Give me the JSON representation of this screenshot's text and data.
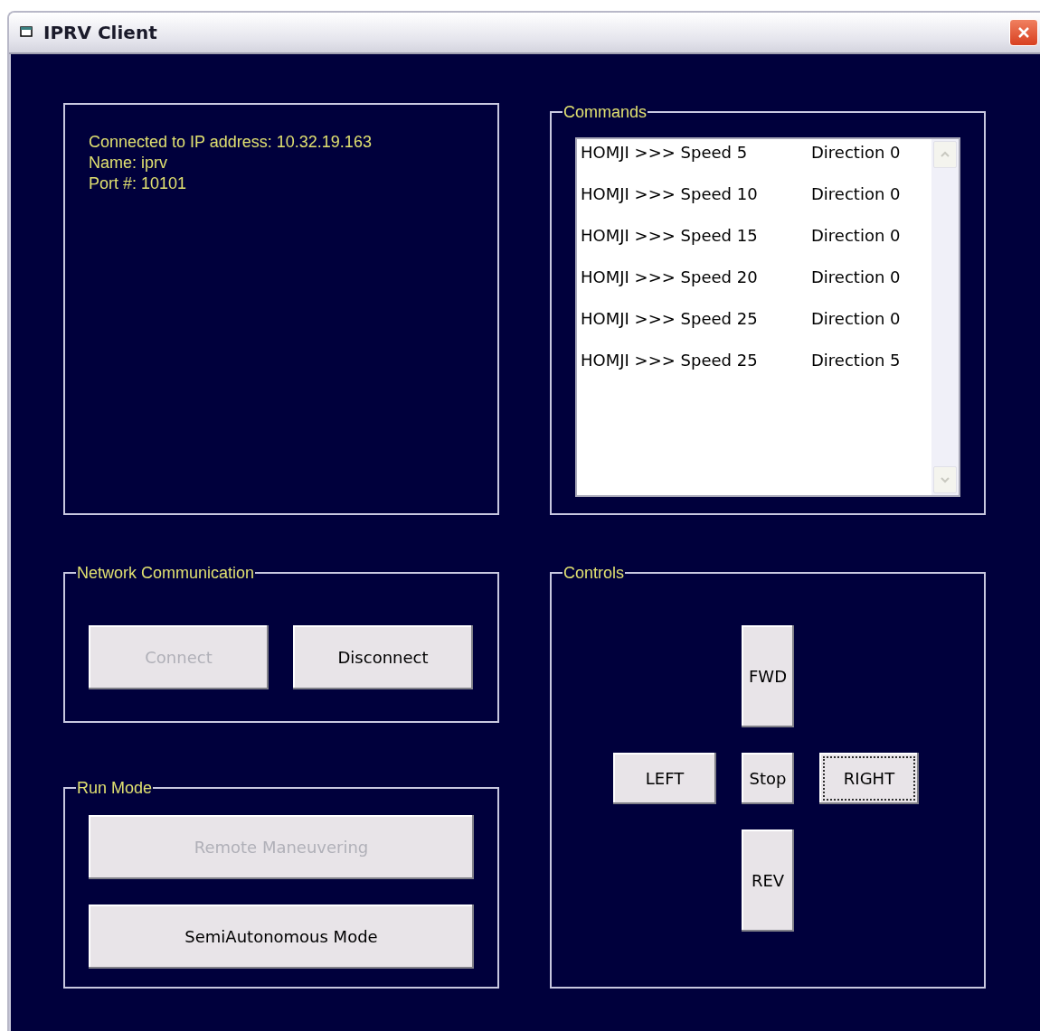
{
  "window": {
    "title": "IPRV Client"
  },
  "status": {
    "lines": [
      "Connected to IP address: 10.32.19.163",
      "Name: iprv",
      "Port #: 10101"
    ]
  },
  "commands": {
    "label": "Commands",
    "items": [
      {
        "command": "HOMJI >>> Speed 5",
        "direction": "Direction 0"
      },
      {
        "command": "HOMJI >>> Speed 10",
        "direction": "Direction 0"
      },
      {
        "command": "HOMJI >>> Speed 15",
        "direction": "Direction 0"
      },
      {
        "command": "HOMJI >>> Speed 20",
        "direction": "Direction 0"
      },
      {
        "command": "HOMJI >>> Speed 25",
        "direction": "Direction 0"
      },
      {
        "command": "HOMJI >>> Speed 25",
        "direction": "Direction 5"
      }
    ]
  },
  "network": {
    "label": "Network Communication",
    "buttons": [
      {
        "label": "Connect",
        "disabled": true
      },
      {
        "label": "Disconnect",
        "disabled": false
      }
    ]
  },
  "run_mode": {
    "label": "Run Mode",
    "buttons": [
      {
        "label": "Remote Maneuvering",
        "disabled": true
      },
      {
        "label": "SemiAutonomous Mode",
        "disabled": false
      }
    ]
  },
  "controls": {
    "label": "Controls",
    "buttons": [
      {
        "label": "FWD",
        "kind": "up",
        "focused": false
      },
      {
        "label": "LEFT",
        "kind": "left",
        "focused": false
      },
      {
        "label": "Stop",
        "kind": "center",
        "focused": false
      },
      {
        "label": "RIGHT",
        "kind": "right",
        "focused": true
      },
      {
        "label": "REV",
        "kind": "down",
        "focused": false
      }
    ]
  }
}
